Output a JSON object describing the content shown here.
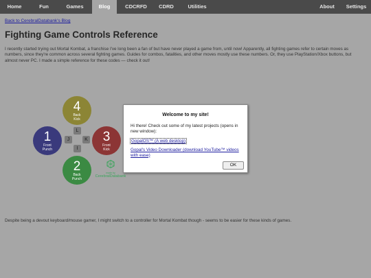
{
  "nav": {
    "items": [
      "Home",
      "Fun",
      "Games",
      "Blog",
      "CDCRFD",
      "CDRD",
      "Utilities"
    ],
    "right_items": [
      "About",
      "Settings"
    ],
    "active": "Blog"
  },
  "back_link": "Back to CerebralDatabank's Blog",
  "page_title": "Fighting Game Controls Reference",
  "intro": "I recently started trying out Mortal Kombat, a franchise I've long been a fan of but have never played a game from, until now! Apparently, all fighting games refer to certain moves as numbers, since they're common across several fighting games. Guides for combos, fatalities, and other moves mostly use these numbers. Or, they use PlayStation/Xbox buttons, but almost never PC. I made a simple reference for these codes — check it out!",
  "diagram": {
    "buttons": [
      {
        "num": "4",
        "line1": "Back",
        "line2": "Kick",
        "color": "#8c8535"
      },
      {
        "num": "1",
        "line1": "Front",
        "line2": "Punch",
        "color": "#3a3a7c"
      },
      {
        "num": "3",
        "line1": "Front",
        "line2": "Kick",
        "color": "#8c3535"
      },
      {
        "num": "2",
        "line1": "Back",
        "line2": "Punch",
        "color": "#3b8a43"
      }
    ],
    "keys": [
      "L",
      "J",
      "K",
      "I"
    ],
    "brand_top": "made by",
    "brand_name": "CerebralDatabank"
  },
  "footer": "Despite being a devout keyboard/mouse gamer, I might switch to a controller for Mortal Kombat though - seems to be easier for these kinds of games.",
  "modal": {
    "title": "Welcome to my site!",
    "body": "Hi there! Check out some of my latest projects (opens in new window):",
    "link1": "GopalOS™ (A web desktop)",
    "link2": "Gopal's Video Downloader (download YouTube™ videos with ease)",
    "ok": "OK"
  }
}
